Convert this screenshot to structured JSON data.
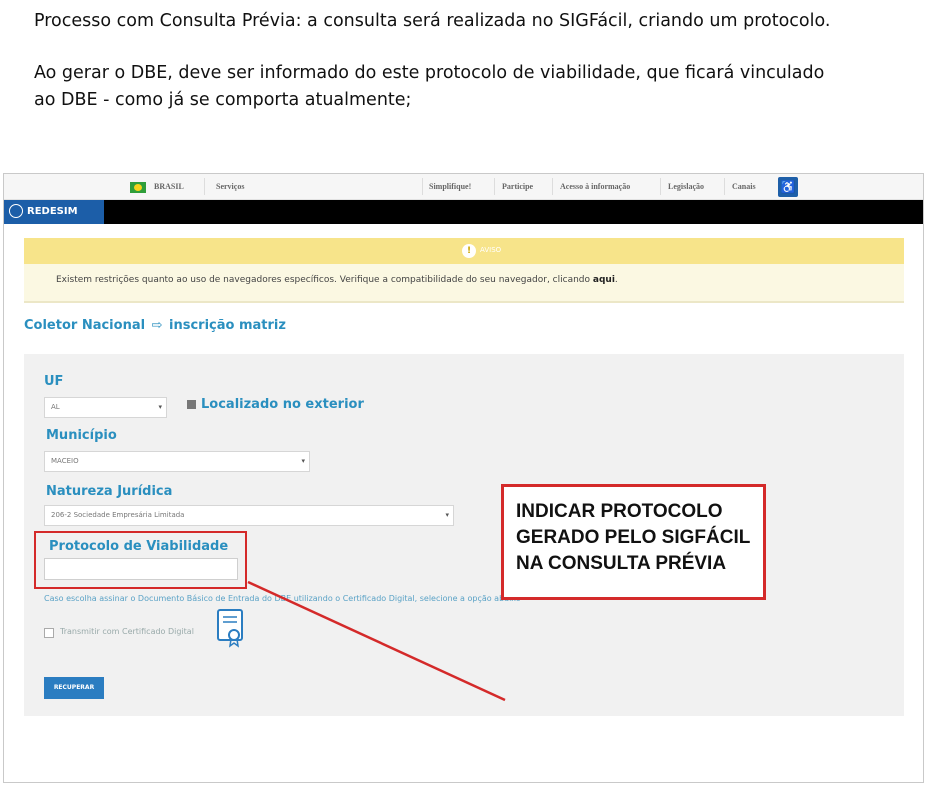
{
  "intro": {
    "p1": "Processo com Consulta Prévia: a consulta será realizada no SIGFácil, criando um protocolo.",
    "p2_line1": "Ao gerar o DBE, deve ser informado do este protocolo de viabilidade, que ficará vinculado",
    "p2_line2": "ao DBE - como já se comporta atualmente;"
  },
  "govbar": {
    "brasil": "BRASIL",
    "servicos": "Serviços",
    "items": [
      "Simplifique!",
      "Participe",
      "Acesso à informação",
      "Legislação",
      "Canais"
    ]
  },
  "header": {
    "logo": "REDESIM"
  },
  "alert": {
    "title": "AVISO",
    "text": "Existem restrições quanto ao uso de navegadores específicos. Verifique a compatibilidade do seu navegador, clicando",
    "link": "aqui"
  },
  "breadcrumb": {
    "first": "Coletor Nacional",
    "arrow": "⇨",
    "second": "inscrição matriz"
  },
  "form": {
    "uf_label": "UF",
    "uf_value": "AL",
    "exterior_label": "Localizado no exterior",
    "municipio_label": "Município",
    "municipio_value": "MACEIO",
    "natureza_label": "Natureza Jurídica",
    "natureza_value": "206-2 Sociedade Empresária Limitada",
    "protocolo_label": "Protocolo de Viabilidade",
    "protocolo_value": "",
    "hint": "Caso escolha assinar o Documento Básico de Entrada do DBE utilizando o Certificado Digital, selecione a opção abaixo",
    "cert_label": "Transmitir com Certificado Digital",
    "recuperar": "RECUPERAR"
  },
  "callout": {
    "line1": "INDICAR PROTOCOLO",
    "line2": "GERADO PELO SIGFÁCIL",
    "line3": "NA CONSULTA PRÉVIA"
  },
  "colors": {
    "accent": "#2a8fbf",
    "highlight": "#d42a2a",
    "alert": "#f7e48a",
    "button": "#2b7dc1"
  }
}
